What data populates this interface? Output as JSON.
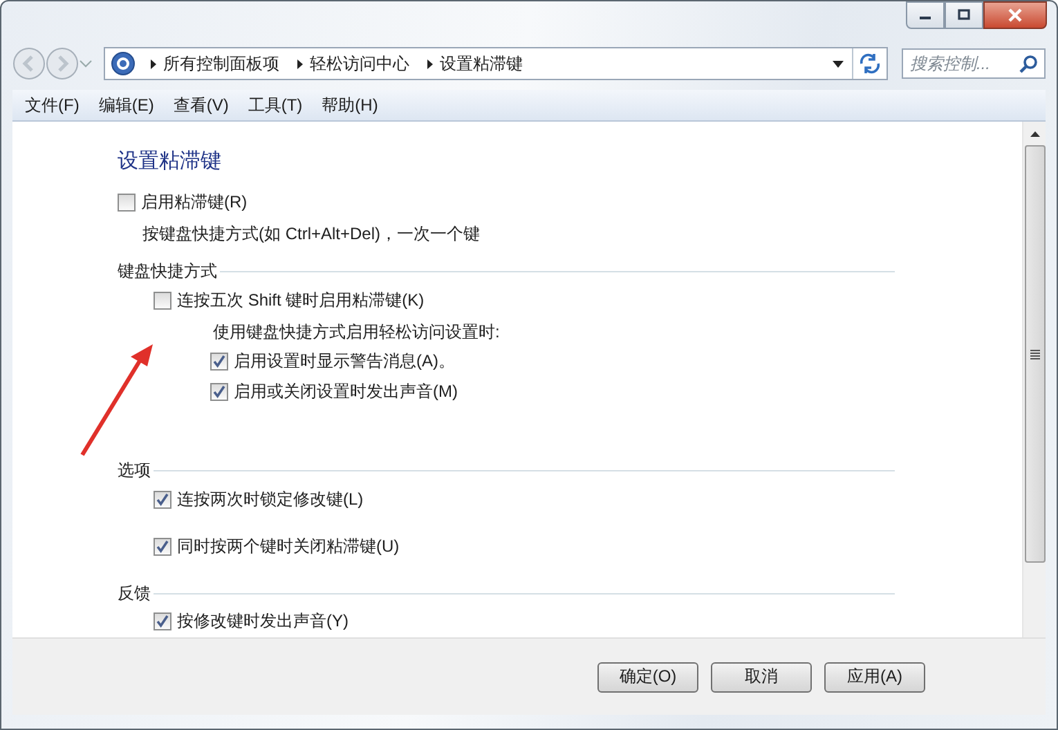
{
  "address": {
    "breadcrumb": [
      "所有控制面板项",
      "轻松访问中心",
      "设置粘滞键"
    ]
  },
  "search": {
    "placeholder": "搜索控制..."
  },
  "menu": [
    "文件(F)",
    "编辑(E)",
    "查看(V)",
    "工具(T)",
    "帮助(H)"
  ],
  "page": {
    "title": "设置粘滞键",
    "items": [
      {
        "kind": "checkbox",
        "label": "启用粘滞键(R)",
        "checked": false
      },
      {
        "kind": "note",
        "text": "按键盘快捷方式(如 Ctrl+Alt+Del)，一次一个键"
      }
    ]
  },
  "sections": [
    {
      "title": "键盘快捷方式",
      "items": [
        {
          "kind": "checkbox",
          "label": "连按五次 Shift 键时启用粘滞键(K)",
          "checked": false,
          "children": [
            {
              "kind": "note",
              "text": "使用键盘快捷方式启用轻松访问设置时:"
            },
            {
              "kind": "checkbox",
              "label": "启用设置时显示警告消息(A)。",
              "checked": true
            },
            {
              "kind": "checkbox",
              "label": "启用或关闭设置时发出声音(M)",
              "checked": true
            }
          ]
        }
      ]
    },
    {
      "title": "选项",
      "items": [
        {
          "kind": "checkbox",
          "label": "连按两次时锁定修改键(L)",
          "checked": true
        },
        {
          "kind": "checkbox",
          "label": "同时按两个键时关闭粘滞键(U)",
          "checked": true
        }
      ]
    },
    {
      "title": "反馈",
      "items": [
        {
          "kind": "checkbox",
          "label": "按修改键时发出声音(Y)",
          "checked": true
        }
      ]
    }
  ],
  "buttons": [
    "确定(O)",
    "取消",
    "应用(A)"
  ]
}
